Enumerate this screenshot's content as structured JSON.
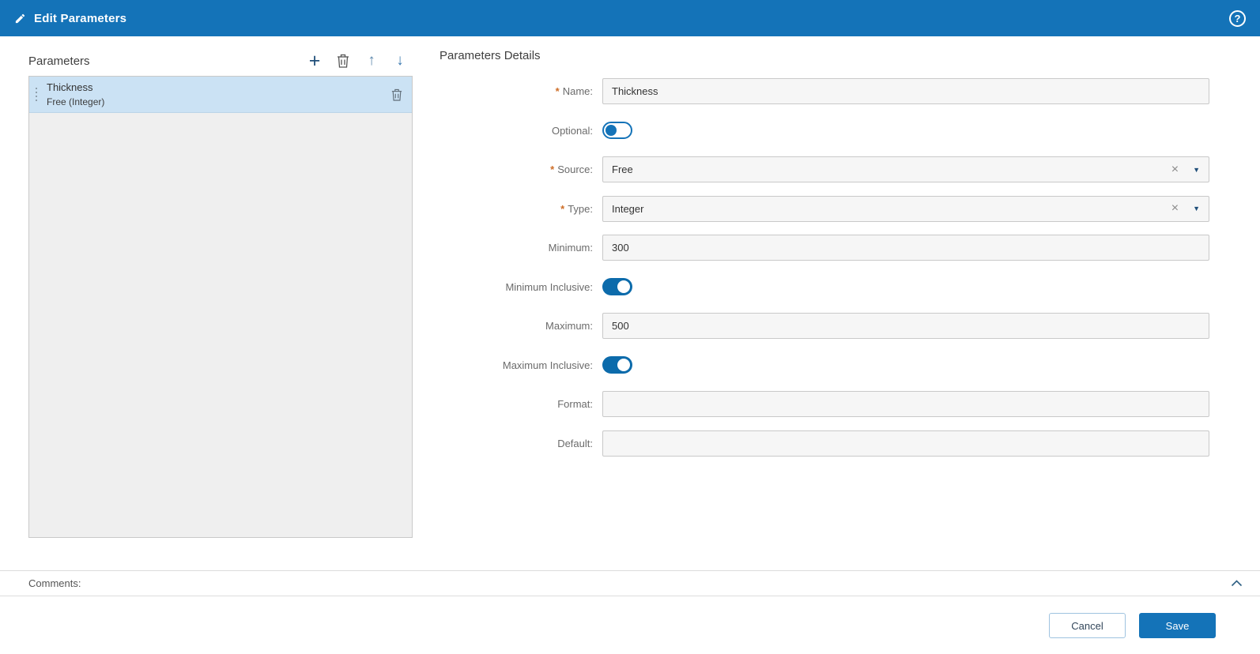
{
  "colors": {
    "header_bg": "#1473b8",
    "accent_blue": "#1473b8",
    "toggle_on": "#0c6bab",
    "selected_item_bg": "#cbe2f4",
    "required_marker_color": "#ce6e28"
  },
  "header": {
    "title": "Edit Parameters"
  },
  "icons": {
    "plus": "+",
    "arrow_up": "↑",
    "arrow_down": "↓",
    "help": "?",
    "clear": "×",
    "caret_down": "▼",
    "required": "*"
  },
  "left_panel": {
    "title": "Parameters",
    "selected_item": {
      "name": "Thickness",
      "subtitle": "Free (Integer)"
    }
  },
  "details": {
    "title": "Parameters Details",
    "fields": {
      "name": {
        "label": "Name:",
        "required": true,
        "value": "Thickness"
      },
      "optional": {
        "label": "Optional:",
        "on": false
      },
      "source": {
        "label": "Source:",
        "required": true,
        "value": "Free"
      },
      "type": {
        "label": "Type:",
        "required": true,
        "value": "Integer"
      },
      "minimum": {
        "label": "Minimum:",
        "value": "300"
      },
      "minimum_inclusive": {
        "label": "Minimum Inclusive:",
        "on": true
      },
      "maximum": {
        "label": "Maximum:",
        "value": "500"
      },
      "maximum_inclusive": {
        "label": "Maximum Inclusive:",
        "on": true
      },
      "format": {
        "label": "Format:",
        "value": ""
      },
      "default": {
        "label": "Default:",
        "value": ""
      }
    }
  },
  "comments": {
    "label": "Comments:"
  },
  "footer": {
    "cancel_label": "Cancel",
    "save_label": "Save"
  }
}
